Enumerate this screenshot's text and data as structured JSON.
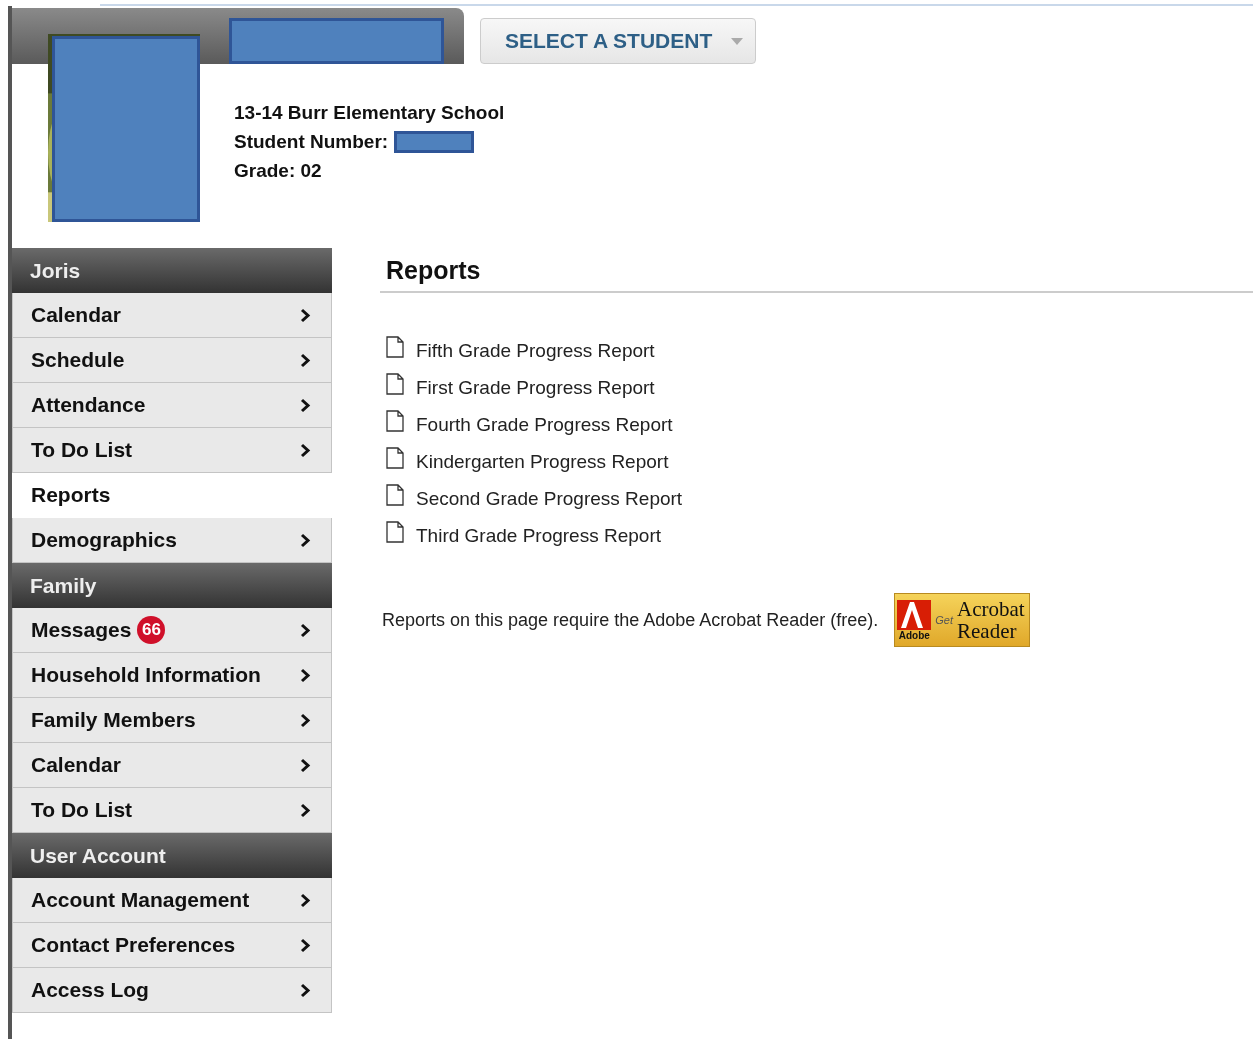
{
  "header": {
    "select_button": {
      "label": "SELECT A STUDENT"
    },
    "student": {
      "school": "13-14 Burr Elementary School",
      "number_label": "Student Number:",
      "grade": "Grade: 02"
    }
  },
  "sidebar": {
    "items": [
      {
        "kind": "header",
        "label": "Joris"
      },
      {
        "kind": "item",
        "label": "Calendar",
        "selected": false
      },
      {
        "kind": "item",
        "label": "Schedule",
        "selected": false
      },
      {
        "kind": "item",
        "label": "Attendance",
        "selected": false
      },
      {
        "kind": "item",
        "label": "To Do List",
        "selected": false
      },
      {
        "kind": "item",
        "label": "Reports",
        "selected": true
      },
      {
        "kind": "item",
        "label": "Demographics",
        "selected": false
      },
      {
        "kind": "header",
        "label": "Family"
      },
      {
        "kind": "item",
        "label": "Messages",
        "badge": "66",
        "selected": false
      },
      {
        "kind": "item",
        "label": "Household Information",
        "selected": false
      },
      {
        "kind": "item",
        "label": "Family Members",
        "selected": false
      },
      {
        "kind": "item",
        "label": "Calendar",
        "selected": false
      },
      {
        "kind": "item",
        "label": "To Do List",
        "selected": false
      },
      {
        "kind": "header",
        "label": "User Account"
      },
      {
        "kind": "item",
        "label": "Account Management",
        "selected": false
      },
      {
        "kind": "item",
        "label": "Contact Preferences",
        "selected": false
      },
      {
        "kind": "item",
        "label": "Access Log",
        "selected": false
      }
    ]
  },
  "main": {
    "title": "Reports",
    "reports": [
      "Fifth Grade Progress Report",
      "First Grade Progress Report",
      "Fourth Grade Progress Report",
      "Kindergarten Progress Report",
      "Second Grade Progress Report",
      "Third Grade Progress Report"
    ],
    "note": "Reports on this page require the Adobe Acrobat Reader (free).",
    "badge": {
      "brand": "Adobe",
      "get": "Get",
      "line1": "Acrobat",
      "line2": "Reader"
    }
  }
}
